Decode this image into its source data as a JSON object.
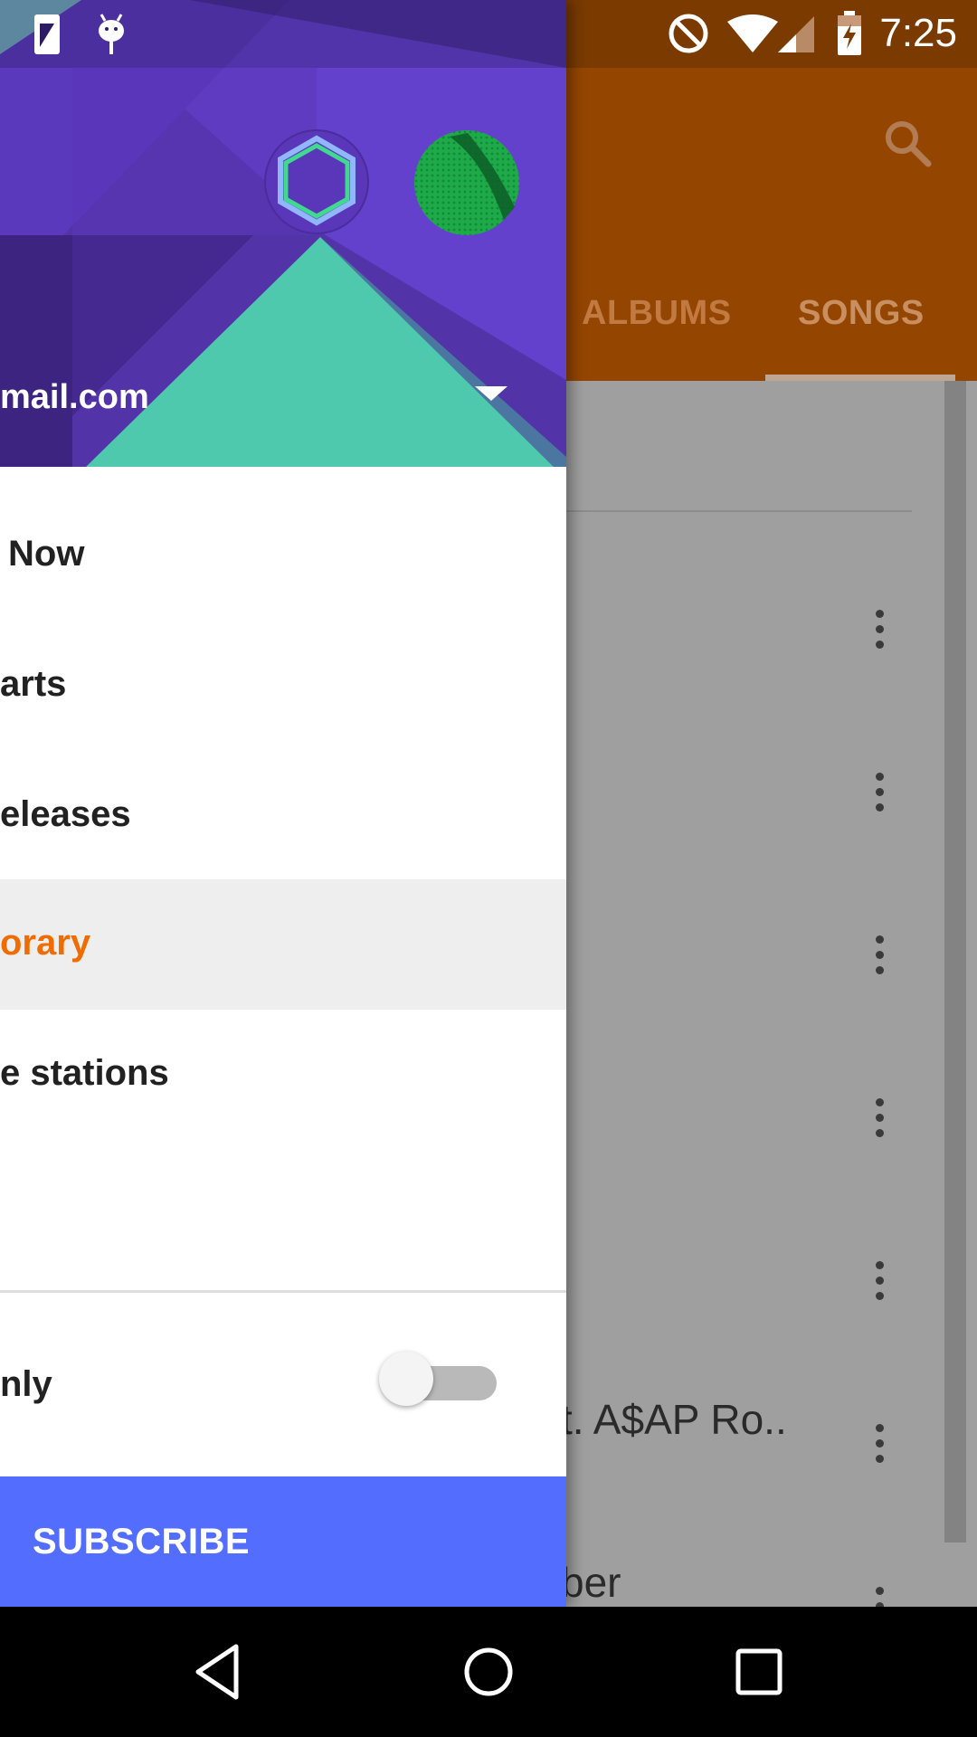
{
  "status_bar": {
    "time": "7:25",
    "icons": [
      "sim-card-icon",
      "android-debug-icon",
      "do-not-disturb-icon",
      "wifi-icon",
      "cell-signal-icon",
      "battery-charging-icon"
    ]
  },
  "app": {
    "tabs": [
      {
        "label": "ALBUMS"
      },
      {
        "label": "SONGS",
        "selected": true
      }
    ],
    "visible_song_fragments": [
      "t. A$AP Ro..",
      "ber"
    ],
    "colors": {
      "toolbar": "#944600",
      "scrim_background": "#9f9f9f"
    }
  },
  "drawer": {
    "account": {
      "email_fragment": "mail.com"
    },
    "items": [
      {
        "label": "Now"
      },
      {
        "label": "arts"
      },
      {
        "label": "eleases"
      },
      {
        "label": "orary",
        "selected": true
      },
      {
        "label": "e stations"
      }
    ],
    "downloaded_only": {
      "label": "nly",
      "toggle_on": false
    },
    "subscribe": {
      "label": "SUBSCRIBE"
    },
    "colors": {
      "header_purple": "#5e35b1",
      "header_teal": "#4fc9ad",
      "selected_text": "#ef6c00",
      "subscribe_bg": "#536dfe"
    }
  },
  "system_nav": {
    "buttons": [
      "back-icon",
      "home-icon",
      "recents-icon"
    ]
  }
}
